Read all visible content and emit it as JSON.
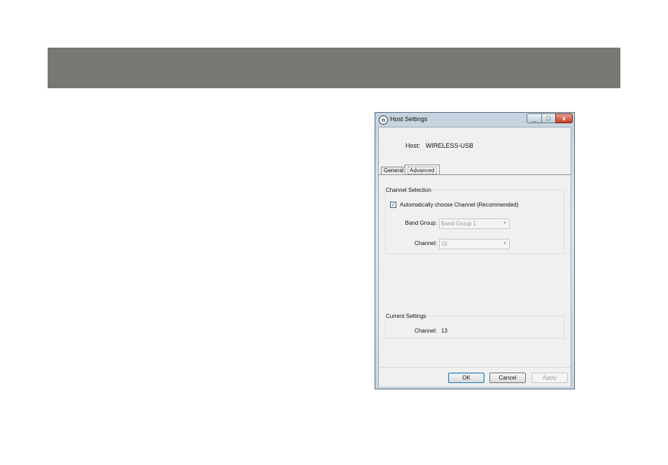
{
  "window": {
    "title": "Host Settings",
    "icon": "network-icon",
    "controls": {
      "minimize": "_",
      "maximize": "□",
      "close": "x"
    }
  },
  "host": {
    "label": "Host:",
    "value": "WIRELESS-USB"
  },
  "tabs": [
    {
      "label": "General",
      "selected": false
    },
    {
      "label": "Advanced",
      "selected": true
    }
  ],
  "channel_selection": {
    "title": "Channel Selection",
    "auto_checkbox": {
      "label": "Automatically choose Channel (Recommended)",
      "checked": true
    },
    "band_group": {
      "label": "Band Group:",
      "value": "Band Group 1",
      "enabled": false
    },
    "channel": {
      "label": "Channel:",
      "value": "15",
      "enabled": false
    }
  },
  "current_settings": {
    "title": "Current Settings",
    "channel_label": "Channel:",
    "channel_value": "13"
  },
  "buttons": {
    "ok": "OK",
    "cancel": "Cancel",
    "apply": "Apply"
  },
  "colors": {
    "header_bar": "#777872",
    "dialog_bg": "#f0f0f0"
  }
}
